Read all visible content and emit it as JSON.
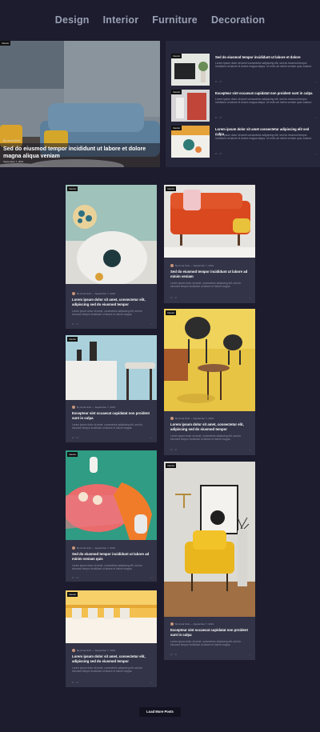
{
  "nav": [
    "Design",
    "Interior",
    "Furniture",
    "Decoration"
  ],
  "hero": {
    "tag": "Interior",
    "byline": "By Anna Smit",
    "title": "Sed do eiusmod tempor incididunt ut labore et dolore magna aliqua veniam",
    "date": "September 7, 2021"
  },
  "side": [
    {
      "tag": "Interior",
      "title": "Sed do eiusmod tempor incididunt ut labore et dolore",
      "excerpt": "Lorem ipsum dolor sit amet consectetur adipiscing elit, sed do eiusmod tempor incididunt ut labore et dolore magna aliqua. Ut enim ad minim veniam quis nostrud.",
      "meta": "0  ♡ 0",
      "arrow": "→"
    },
    {
      "tag": "Interior",
      "title": "Excepteur sint occaecat cupidatat non proident sunt in culpa",
      "excerpt": "Lorem ipsum dolor sit amet consectetur adipiscing elit, sed do eiusmod tempor incididunt ut labore et dolore magna aliqua. Ut enim ad minim veniam quis nostrud.",
      "meta": "0  ♡ 0",
      "arrow": "→"
    },
    {
      "tag": "Interior",
      "title": "Lorem ipsum dolor sit amet consectetur adipiscing elit sed culpa",
      "excerpt": "Lorem ipsum dolor sit amet consectetur adipiscing elit, sed do eiusmod tempor incididunt ut labore et dolore magna aliqua. Ut enim ad minim veniam quis nostrud.",
      "meta": "0  ♡ 0",
      "arrow": "→"
    }
  ],
  "cards": [
    {
      "tag": "Interior",
      "author": "By Anna Smit  —  September 7, 2021",
      "title": "Lorem ipsum dolor sit amet, consectetur elit, adipiscing sed do eiusmod tempor",
      "excerpt": "Lorem ipsum dolor sit amet, consectetur adipiscing elit, sed do eiusmod tempor incididunt ut labore et dolore magna.",
      "meta": "0  ♡ 0",
      "arrow": "→"
    },
    {
      "tag": "Interior",
      "author": "By Anna Smit  —  September 7, 2021",
      "title": "Sed do eiusmod tempor incididunt ut labore ad minim veniam",
      "excerpt": "Lorem ipsum dolor sit amet, consectetur adipiscing elit, sed do eiusmod tempor incididunt ut labore et dolore magna.",
      "meta": "0  ♡ 0",
      "arrow": "→"
    },
    {
      "tag": "Interior",
      "author": "By Anna Smit  —  September 7, 2021",
      "title": "Excepteur sint occaecat cupidatat non proident sunt in culpa",
      "excerpt": "Lorem ipsum dolor sit amet, consectetur adipiscing elit, sed do eiusmod tempor incididunt ut labore et dolore magna.",
      "meta": "0  ♡ 0",
      "arrow": "→"
    },
    {
      "tag": "Interior",
      "author": "By Anna Smit  —  September 7, 2021",
      "title": "Lorem ipsum dolor sit amet, consectetur elit, adipiscing sed do eiusmod tempor",
      "excerpt": "Lorem ipsum dolor sit amet, consectetur adipiscing elit, sed do eiusmod tempor incididunt ut labore et dolore magna.",
      "meta": "0  ♡ 0",
      "arrow": "→"
    },
    {
      "tag": "Interior",
      "author": "By Anna Smit  —  September 7, 2021",
      "title": "Sed do eiusmod tempor incididunt ut labore ad minim veniam quis",
      "excerpt": "Lorem ipsum dolor sit amet, consectetur adipiscing elit, sed do eiusmod tempor incididunt ut labore et dolore magna.",
      "meta": "0  ♡ 0",
      "arrow": "→"
    },
    {
      "tag": "Interior",
      "author": "By Anna Smit  —  September 7, 2021",
      "title": "Excepteur sint occaecat cupidatat non proident sunt in culpa",
      "excerpt": "Lorem ipsum dolor sit amet, consectetur adipiscing elit, sed do eiusmod tempor incididunt ut labore et dolore magna.",
      "meta": "0  ♡ 0",
      "arrow": "→"
    },
    {
      "tag": "Interior",
      "author": "By Anna Smit  —  September 7, 2021",
      "title": "Lorem ipsum dolor sit amet, consectetur elit, adipiscing sed do eiusmod tempor",
      "excerpt": "Lorem ipsum dolor sit amet, consectetur adipiscing elit, sed do eiusmod tempor incididunt ut labore et dolore magna.",
      "meta": "0  ♡ 0",
      "arrow": "→"
    }
  ],
  "load_more": "Load More Posts"
}
